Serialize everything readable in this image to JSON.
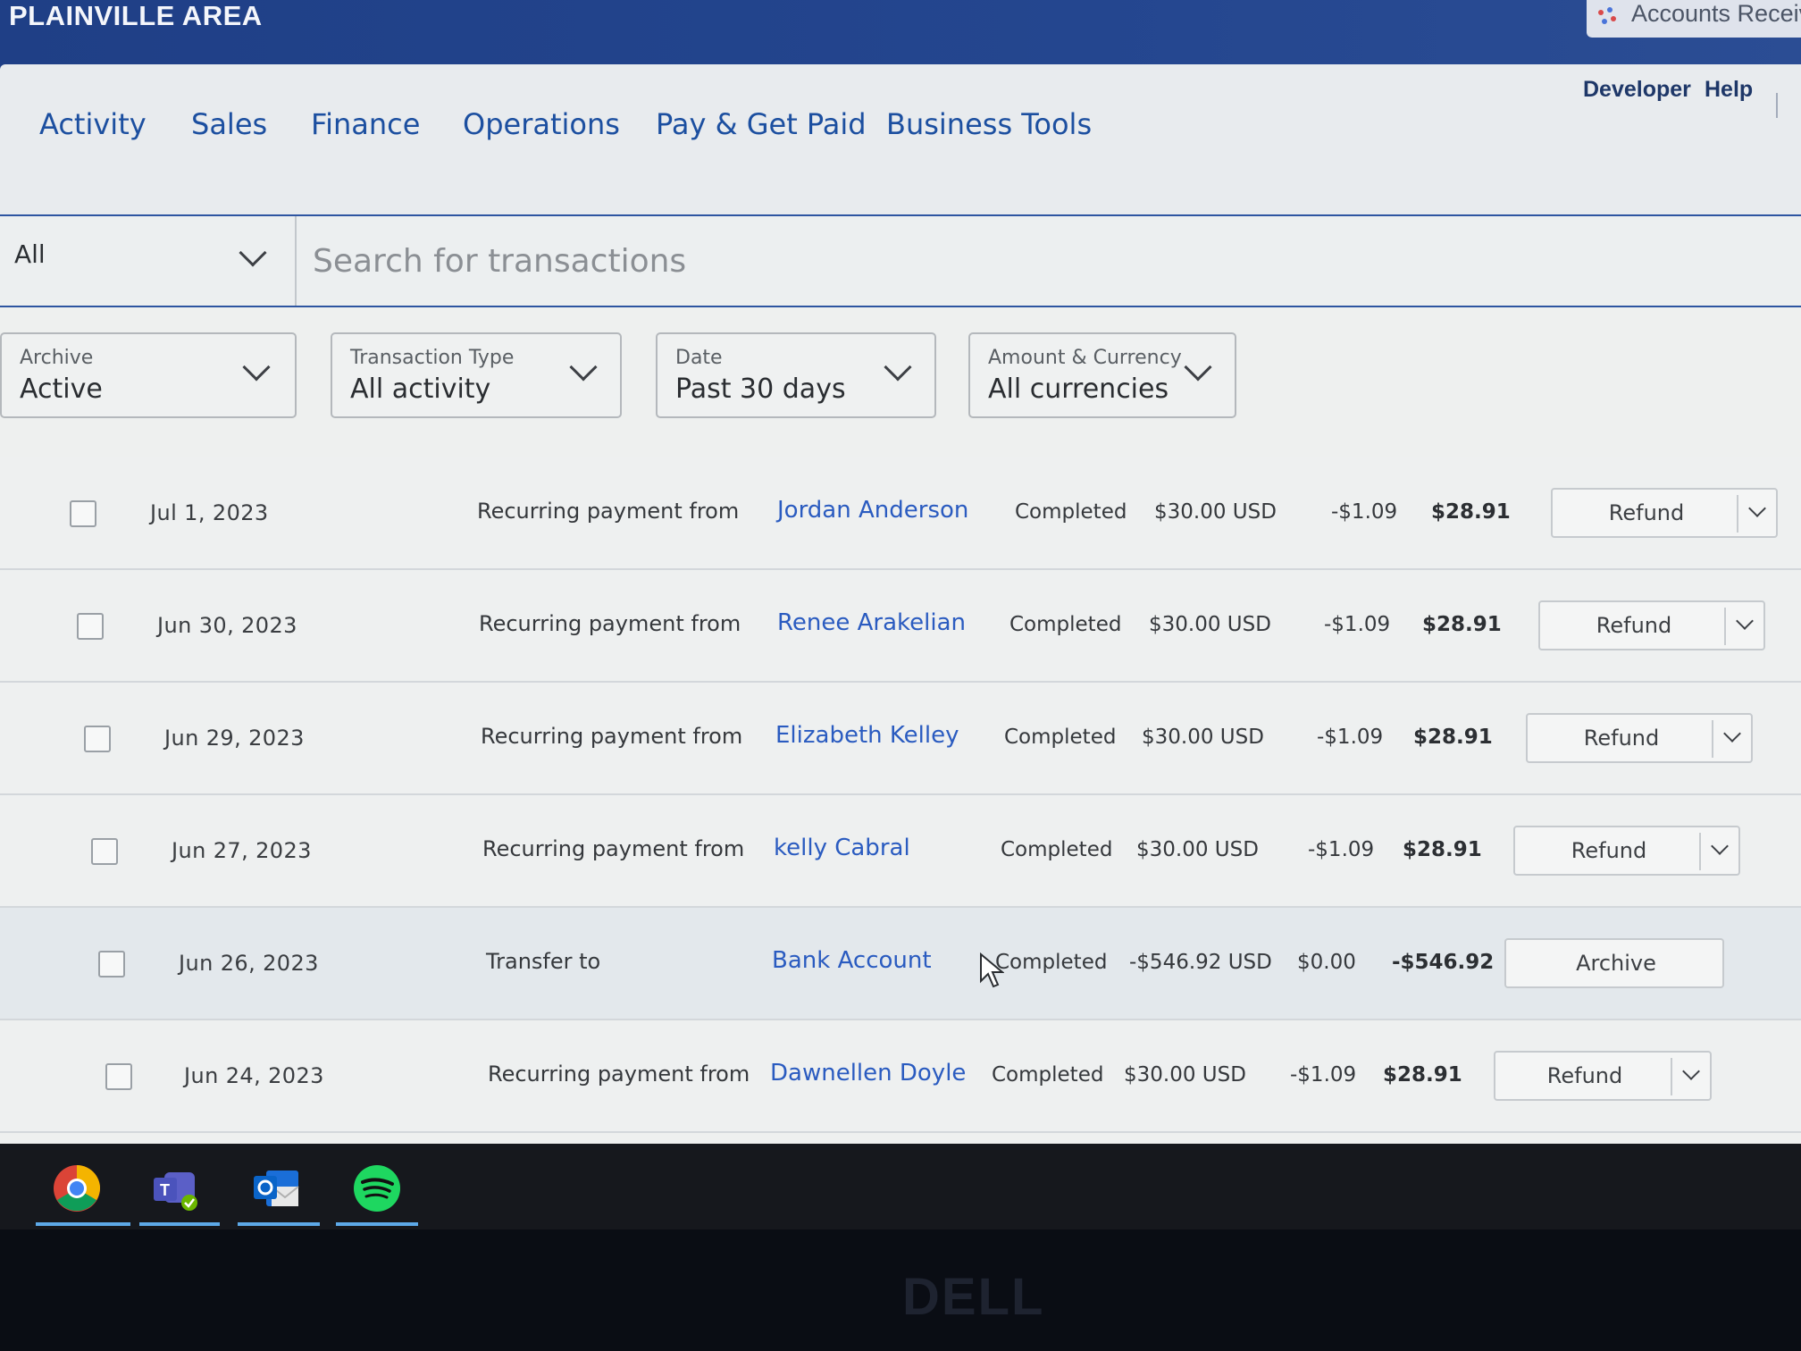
{
  "header": {
    "org_name": "PLAINVILLE AREA",
    "app_label": "Accounts Receiv",
    "utility_links": [
      "Developer",
      "Help"
    ]
  },
  "nav": {
    "items": [
      "Activity",
      "Sales",
      "Finance",
      "Operations",
      "Pay & Get Paid",
      "Business Tools"
    ]
  },
  "search": {
    "scope_value": "All",
    "placeholder": "Search for transactions"
  },
  "filters": [
    {
      "label": "Archive",
      "value": "Active"
    },
    {
      "label": "Transaction Type",
      "value": "All activity"
    },
    {
      "label": "Date",
      "value": "Past 30 days"
    },
    {
      "label": "Amount & Currency",
      "value": "All currencies"
    }
  ],
  "transactions": [
    {
      "date": "Jul 1, 2023",
      "description": "Recurring payment from",
      "party": "Jordan Anderson",
      "status": "Completed",
      "gross": "$30.00 USD",
      "fee": "-$1.09",
      "net": "$28.91",
      "action": "Refund",
      "has_menu": true
    },
    {
      "date": "Jun 30, 2023",
      "description": "Recurring payment from",
      "party": "Renee Arakelian",
      "status": "Completed",
      "gross": "$30.00 USD",
      "fee": "-$1.09",
      "net": "$28.91",
      "action": "Refund",
      "has_menu": true
    },
    {
      "date": "Jun 29, 2023",
      "description": "Recurring payment from",
      "party": "Elizabeth Kelley",
      "status": "Completed",
      "gross": "$30.00 USD",
      "fee": "-$1.09",
      "net": "$28.91",
      "action": "Refund",
      "has_menu": true
    },
    {
      "date": "Jun 27, 2023",
      "description": "Recurring payment from",
      "party": "kelly Cabral",
      "status": "Completed",
      "gross": "$30.00 USD",
      "fee": "-$1.09",
      "net": "$28.91",
      "action": "Refund",
      "has_menu": true
    },
    {
      "date": "Jun 26, 2023",
      "description": "Transfer to",
      "party": "Bank Account",
      "status": "Completed",
      "gross": "-$546.92 USD",
      "fee": "$0.00",
      "net": "-$546.92",
      "action": "Archive",
      "has_menu": false
    },
    {
      "date": "Jun 24, 2023",
      "description": "Recurring payment from",
      "party": "Dawnellen Doyle",
      "status": "Completed",
      "gross": "$30.00 USD",
      "fee": "-$1.09",
      "net": "$28.91",
      "action": "Refund",
      "has_menu": true
    }
  ],
  "taskbar": {
    "apps": [
      "chrome-icon",
      "teams-icon",
      "outlook-icon",
      "spotify-icon"
    ]
  },
  "monitor_brand": "DELL"
}
